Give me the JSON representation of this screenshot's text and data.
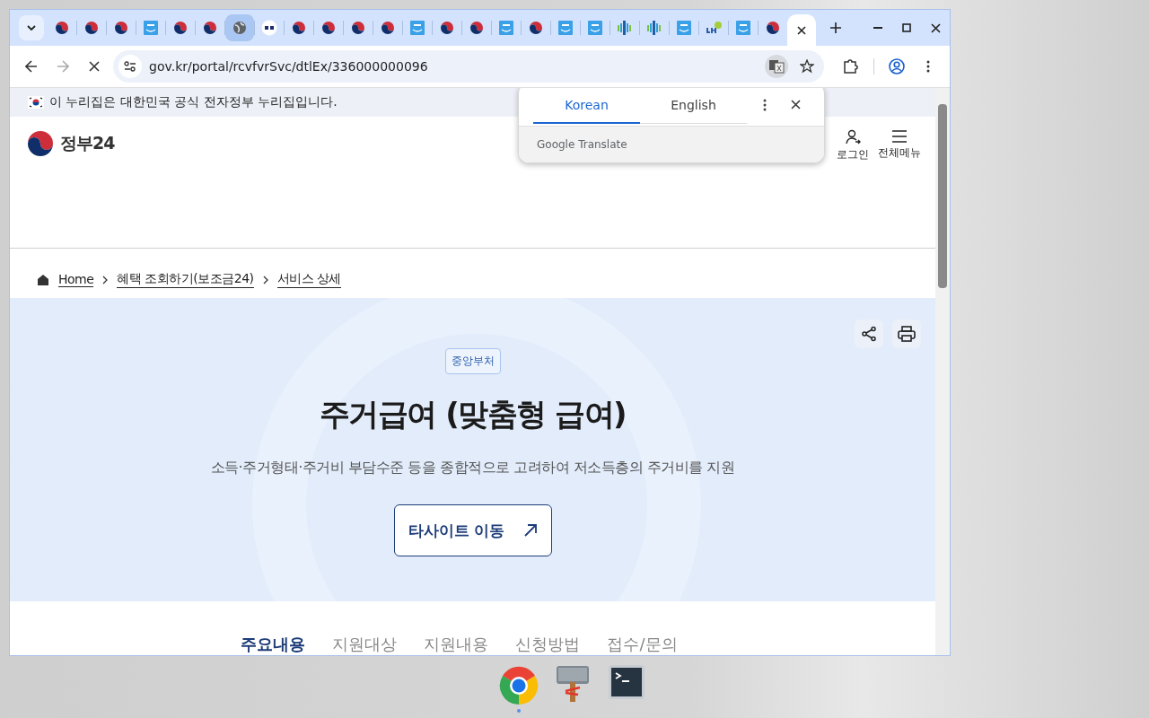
{
  "browser": {
    "tabs": [
      {
        "kind": "taeguk",
        "hovered": false,
        "selected": false
      },
      {
        "kind": "taeguk",
        "hovered": false,
        "selected": false
      },
      {
        "kind": "taeguk",
        "hovered": false,
        "selected": false
      },
      {
        "kind": "square",
        "hovered": false,
        "selected": false
      },
      {
        "kind": "taeguk",
        "hovered": false,
        "selected": false
      },
      {
        "kind": "taeguk",
        "hovered": false,
        "selected": false
      },
      {
        "kind": "globe",
        "hovered": true,
        "selected": false
      },
      {
        "kind": "seal",
        "hovered": false,
        "selected": false
      },
      {
        "kind": "taeguk",
        "hovered": false,
        "selected": false
      },
      {
        "kind": "taeguk",
        "hovered": false,
        "selected": false
      },
      {
        "kind": "taeguk",
        "hovered": false,
        "selected": false
      },
      {
        "kind": "taeguk",
        "hovered": false,
        "selected": false
      },
      {
        "kind": "square",
        "hovered": false,
        "selected": false
      },
      {
        "kind": "taeguk",
        "hovered": false,
        "selected": false
      },
      {
        "kind": "taeguk",
        "hovered": false,
        "selected": false
      },
      {
        "kind": "square",
        "hovered": false,
        "selected": false
      },
      {
        "kind": "taeguk",
        "hovered": false,
        "selected": false
      },
      {
        "kind": "square",
        "hovered": false,
        "selected": false
      },
      {
        "kind": "square",
        "hovered": false,
        "selected": false
      },
      {
        "kind": "bars",
        "hovered": false,
        "selected": false
      },
      {
        "kind": "bars",
        "hovered": false,
        "selected": false
      },
      {
        "kind": "square",
        "hovered": false,
        "selected": false
      },
      {
        "kind": "dot",
        "hovered": false,
        "selected": false
      },
      {
        "kind": "square",
        "hovered": false,
        "selected": false
      },
      {
        "kind": "taeguk",
        "hovered": false,
        "selected": false
      },
      {
        "kind": "blank",
        "hovered": false,
        "selected": true
      }
    ],
    "url": "gov.kr/portal/rcvfvrSvc/dtlEx/336000000096"
  },
  "page": {
    "gov_banner": "이 누리집은 대한민국 공식 전자정부 누리집입니다.",
    "logo_text": "정부24",
    "header_links": [
      {
        "label": "로그인",
        "kind": "user"
      },
      {
        "label": "전체메뉴",
        "kind": "menu"
      }
    ],
    "breadcrumb": [
      "Home",
      "혜택 조회하기(보조금24)",
      "서비스 상세"
    ],
    "hero": {
      "tag": "중앙부처",
      "title": "주거급여 (맞춤형 급여)",
      "subtitle": "소득·주거형태·주거비 부담수준 등을 종합적으로 고려하여 저소득층의 주거비를 지원",
      "button": "타사이트 이동"
    },
    "section_tabs": [
      {
        "label": "주요내용",
        "selected": true
      },
      {
        "label": "지원대상",
        "selected": false
      },
      {
        "label": "지원내용",
        "selected": false
      },
      {
        "label": "신청방법",
        "selected": false
      },
      {
        "label": "접수/문의",
        "selected": false
      }
    ]
  },
  "translate_popup": {
    "languages": [
      {
        "label": "Korean",
        "selected": true
      },
      {
        "label": "English",
        "selected": false
      }
    ],
    "footer": "Google Translate"
  },
  "dock": [
    {
      "kind": "chrome",
      "running": true
    },
    {
      "kind": "tool",
      "running": false
    },
    {
      "kind": "terminal",
      "running": false
    }
  ]
}
